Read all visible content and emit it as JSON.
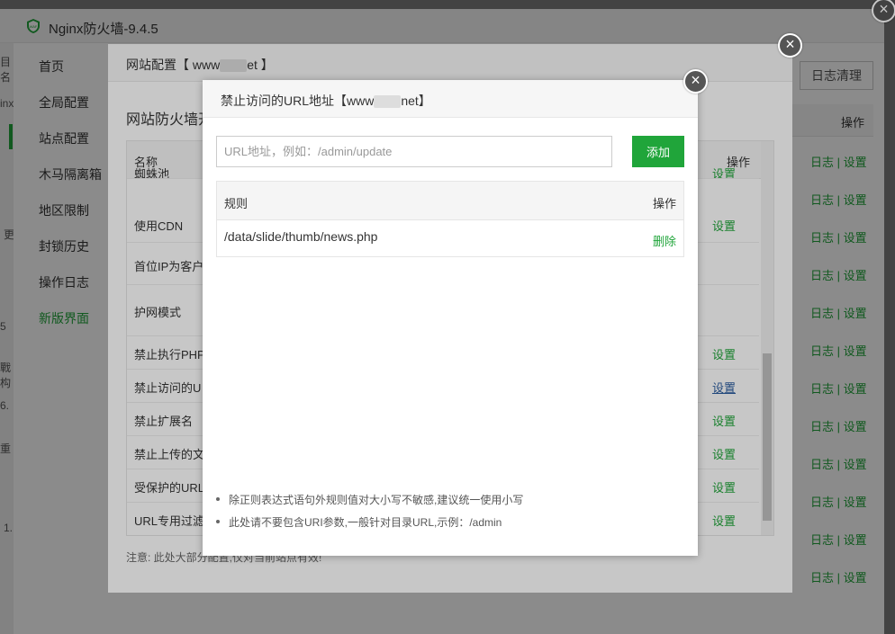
{
  "app": {
    "title": "Nginx防火墙-9.4.5",
    "nav": [
      "首页",
      "全局配置",
      "站点配置",
      "木马隔离箱",
      "地区限制",
      "封锁历史",
      "操作日志",
      "新版界面"
    ],
    "clean_log_button": "日志清理",
    "op_header": "操作",
    "log_links": "日志 | 设置",
    "left_fragments": [
      "目名",
      "inx",
      "更",
      "5",
      "戰构",
      "6.",
      "重",
      "1."
    ]
  },
  "site_dialog": {
    "title_prefix": "网站配置【 www",
    "title_suffix": "et 】",
    "heading": "网站防火墙开",
    "col_name": "名称",
    "col_op": "操作",
    "rows": [
      {
        "name": "蜘蛛池",
        "op": "设置"
      },
      {
        "name": "使用CDN",
        "op": "设置"
      },
      {
        "name": "首位IP为客户",
        "op": ""
      },
      {
        "name": "护网模式",
        "op": ""
      },
      {
        "name": "禁止执行PHP",
        "op": "设置"
      },
      {
        "name": "禁止访问的U",
        "op": "设置"
      },
      {
        "name": "禁止扩展名",
        "op": "设置"
      },
      {
        "name": "禁止上传的文",
        "op": "设置"
      },
      {
        "name": "受保护的URL",
        "op": "设置"
      },
      {
        "name": "URL专用过滤",
        "op": "设置"
      }
    ],
    "note": "注意: 此处大部分配置,仅对当前站点有效!"
  },
  "url_modal": {
    "title_prefix": "禁止访问的URL地址【www",
    "title_suffix": "net】",
    "input_placeholder": "URL地址，例如：/admin/update",
    "input_value": "",
    "add_button": "添加",
    "col_rule": "规则",
    "col_op": "操作",
    "rules": [
      {
        "path": "/data/slide/thumb/news.php",
        "action": "删除"
      }
    ],
    "tips": [
      "除正则表达式语句外规则值对大小写不敏感,建议统一使用小写",
      "此处请不要包含URI参数,一般针对目录URL,示例：/admin"
    ]
  },
  "icons": {
    "close": "close-icon",
    "logo": "shield-logo-icon"
  },
  "colors": {
    "accent": "#20a53a",
    "link_blue": "#2b5d9f"
  }
}
